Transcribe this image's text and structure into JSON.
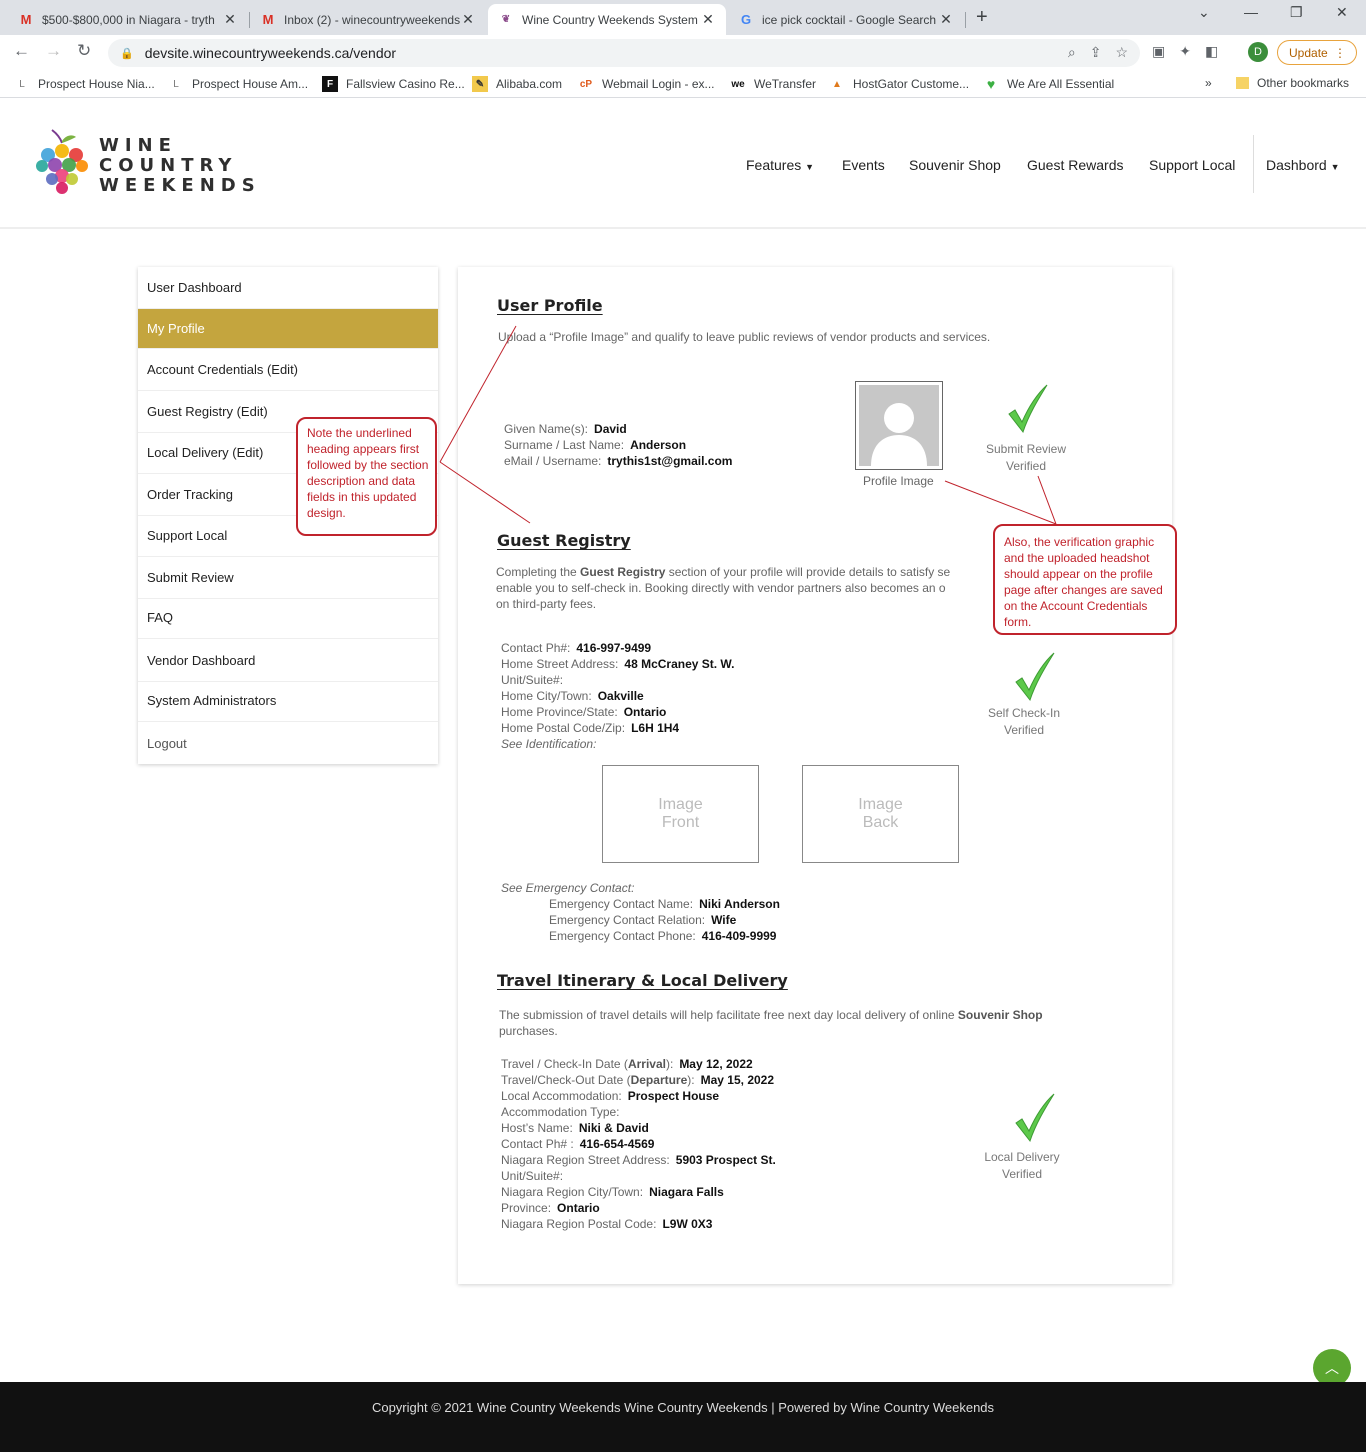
{
  "browser": {
    "tabs": [
      {
        "title": "$500-$800,000 in Niagara - tryth",
        "icon": "gmail-icon"
      },
      {
        "title": "Inbox (2) - winecountryweekends",
        "icon": "gmail-icon"
      },
      {
        "title": "Wine Country Weekends System",
        "icon": "wcw-icon"
      },
      {
        "title": "ice pick cocktail - Google Search",
        "icon": "google-icon"
      }
    ],
    "url": "devsite.winecountryweekends.ca/vendor",
    "profile_initial": "D",
    "update_label": "Update",
    "bookmarks": [
      "Prospect House Nia...",
      "Prospect House Am...",
      "Fallsview Casino Re...",
      "Alibaba.com",
      "Webmail Login - ex...",
      "WeTransfer",
      "HostGator Custome...",
      "We Are All Essential"
    ],
    "other_bookmarks": "Other bookmarks"
  },
  "site": {
    "logo_lines": [
      "WINE",
      "COUNTRY",
      "WEEKENDS"
    ],
    "nav": [
      "Features",
      "Events",
      "Souvenir Shop",
      "Guest Rewards",
      "Support Local",
      "Dashbord"
    ]
  },
  "sidebar": {
    "items": [
      "User Dashboard",
      "My Profile",
      "Account Credentials (Edit)",
      "Guest Registry (Edit)",
      "Local Delivery (Edit)",
      "Order Tracking",
      "Support Local",
      "Submit Review",
      "FAQ",
      "Vendor Dashboard",
      "System Administrators",
      "Logout"
    ],
    "active_color": "#c4a53e"
  },
  "user_profile": {
    "title": "User Profile",
    "description": "Upload a “Profile Image” and qualify to leave public reviews of vendor products and services.",
    "fields": [
      {
        "label": "Given Name(s):",
        "value": "David"
      },
      {
        "label": "Surname / Last Name:",
        "value": "Anderson"
      },
      {
        "label": "eMail / Username:",
        "value": "trythis1st@gmail.com"
      }
    ],
    "image_caption": "Profile Image",
    "verify_line1": "Submit Review",
    "verify_line2": "Verified"
  },
  "guest_registry": {
    "title": "Guest Registry",
    "desc_pre": "Completing the ",
    "desc_bold": "Guest Registry",
    "desc_post1": " section of your profile will provide details to satisfy se",
    "desc_line2": "enable you to self-check in.  Booking directly with vendor partners also becomes an o",
    "desc_line3": "on third-party fees.",
    "fields": [
      {
        "label": "Contact Ph#:",
        "value": "416-997-9499"
      },
      {
        "label": "Home Street Address:",
        "value": "48 McCraney St. W."
      },
      {
        "label": "Unit/Suite#:",
        "value": ""
      },
      {
        "label": "Home City/Town:",
        "value": "Oakville"
      },
      {
        "label": "Home Province/State:",
        "value": "Ontario"
      },
      {
        "label": "Home Postal Code/Zip:",
        "value": "L6H 1H4"
      }
    ],
    "see_identification": "See Identification:",
    "id_front": [
      "Image",
      "Front"
    ],
    "id_back": [
      "Image",
      "Back"
    ],
    "see_emergency": "See Emergency Contact:",
    "emergency": [
      {
        "label": "Emergency Contact Name:",
        "value": "Niki Anderson"
      },
      {
        "label": "Emergency Contact Relation:",
        "value": "Wife"
      },
      {
        "label": "Emergency Contact Phone:",
        "value": "416-409-9999"
      }
    ],
    "verify_line1": "Self Check-In",
    "verify_line2": "Verified"
  },
  "travel": {
    "title": "Travel Itinerary & Local Delivery",
    "desc_pre": "The submission of travel details will help facilitate free next day local delivery of online ",
    "desc_bold": "Souvenir Shop",
    "desc_line2": "purchases.",
    "fields": [
      {
        "pre": "Travel / Check-In Date (",
        "bold": "Arrival",
        "post": "):",
        "value": "May 12, 2022"
      },
      {
        "pre": "Travel/Check-Out Date (",
        "bold": "Departure",
        "post": "):",
        "value": "May 15, 2022"
      },
      {
        "pre": "Local Accommodation:",
        "bold": "",
        "post": "",
        "value": "Prospect House"
      },
      {
        "pre": "Accommodation Type:",
        "bold": "",
        "post": "",
        "value": ""
      },
      {
        "pre": "Host’s Name:",
        "bold": "",
        "post": "",
        "value": "Niki & David"
      },
      {
        "pre": "Contact Ph# :",
        "bold": "",
        "post": "",
        "value": "416-654-4569"
      },
      {
        "pre": "Niagara Region Street Address:",
        "bold": "",
        "post": "",
        "value": "5903 Prospect St."
      },
      {
        "pre": "Unit/Suite#:",
        "bold": "",
        "post": "",
        "value": ""
      },
      {
        "pre": "Niagara Region City/Town:",
        "bold": "",
        "post": "",
        "value": "Niagara Falls"
      },
      {
        "pre": "Province:",
        "bold": "",
        "post": "",
        "value": "Ontario"
      },
      {
        "pre": "Niagara Region Postal Code:",
        "bold": "",
        "post": "",
        "value": "L9W 0X3"
      }
    ],
    "verify_line1": "Local Delivery",
    "verify_line2": "Verified"
  },
  "annotations": {
    "left_note": "Note the underlined heading appears first followed by the section description and data fields in this updated design.",
    "right_note": "Also, the verification graphic and the uploaded headshot should appear on the profile page after changes are saved on the Account Credentials form.",
    "color": "#c0232c"
  },
  "footer": {
    "text": "Copyright © 2021 Wine Country Weekends Wine Country Weekends | Powered by Wine Country Weekends"
  }
}
